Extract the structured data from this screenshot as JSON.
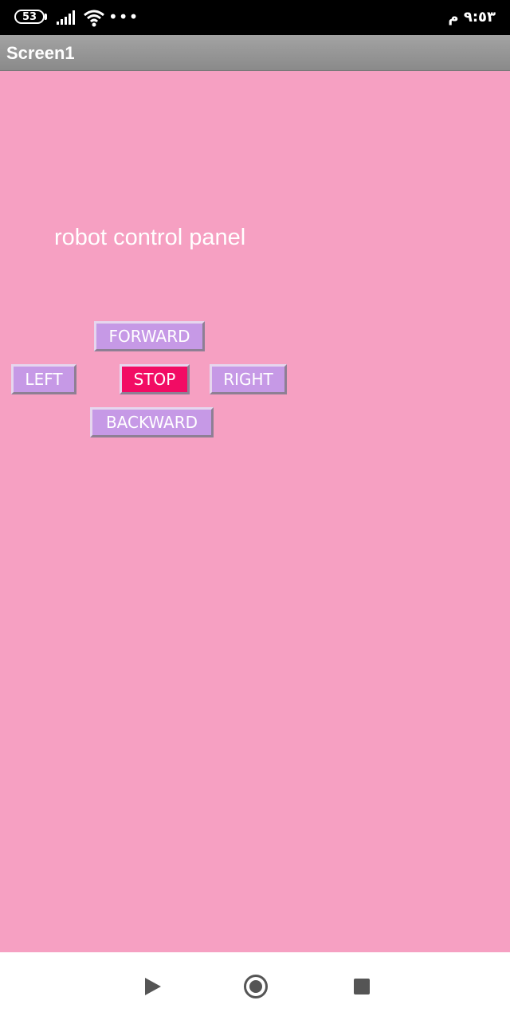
{
  "status_bar": {
    "battery": "53",
    "dots": "•••",
    "time": "٩:٥٣ م",
    "icons": [
      "battery-icon",
      "signal-icon",
      "wifi-icon"
    ]
  },
  "app": {
    "title": "Screen1"
  },
  "main": {
    "label": "robot control panel",
    "buttons": {
      "forward": "FORWARD",
      "left": "LEFT",
      "stop": "STOP",
      "right": "RIGHT",
      "backward": "BACKWARD"
    }
  },
  "nav_bar": {
    "icons": [
      "back-icon",
      "home-icon",
      "recent-apps-icon"
    ]
  },
  "colors": {
    "background": "#f6a0c2",
    "button": "#c699e6",
    "stop_button": "#f20c64",
    "title_bar": "#8e8e8e",
    "status_bar": "#000000"
  }
}
